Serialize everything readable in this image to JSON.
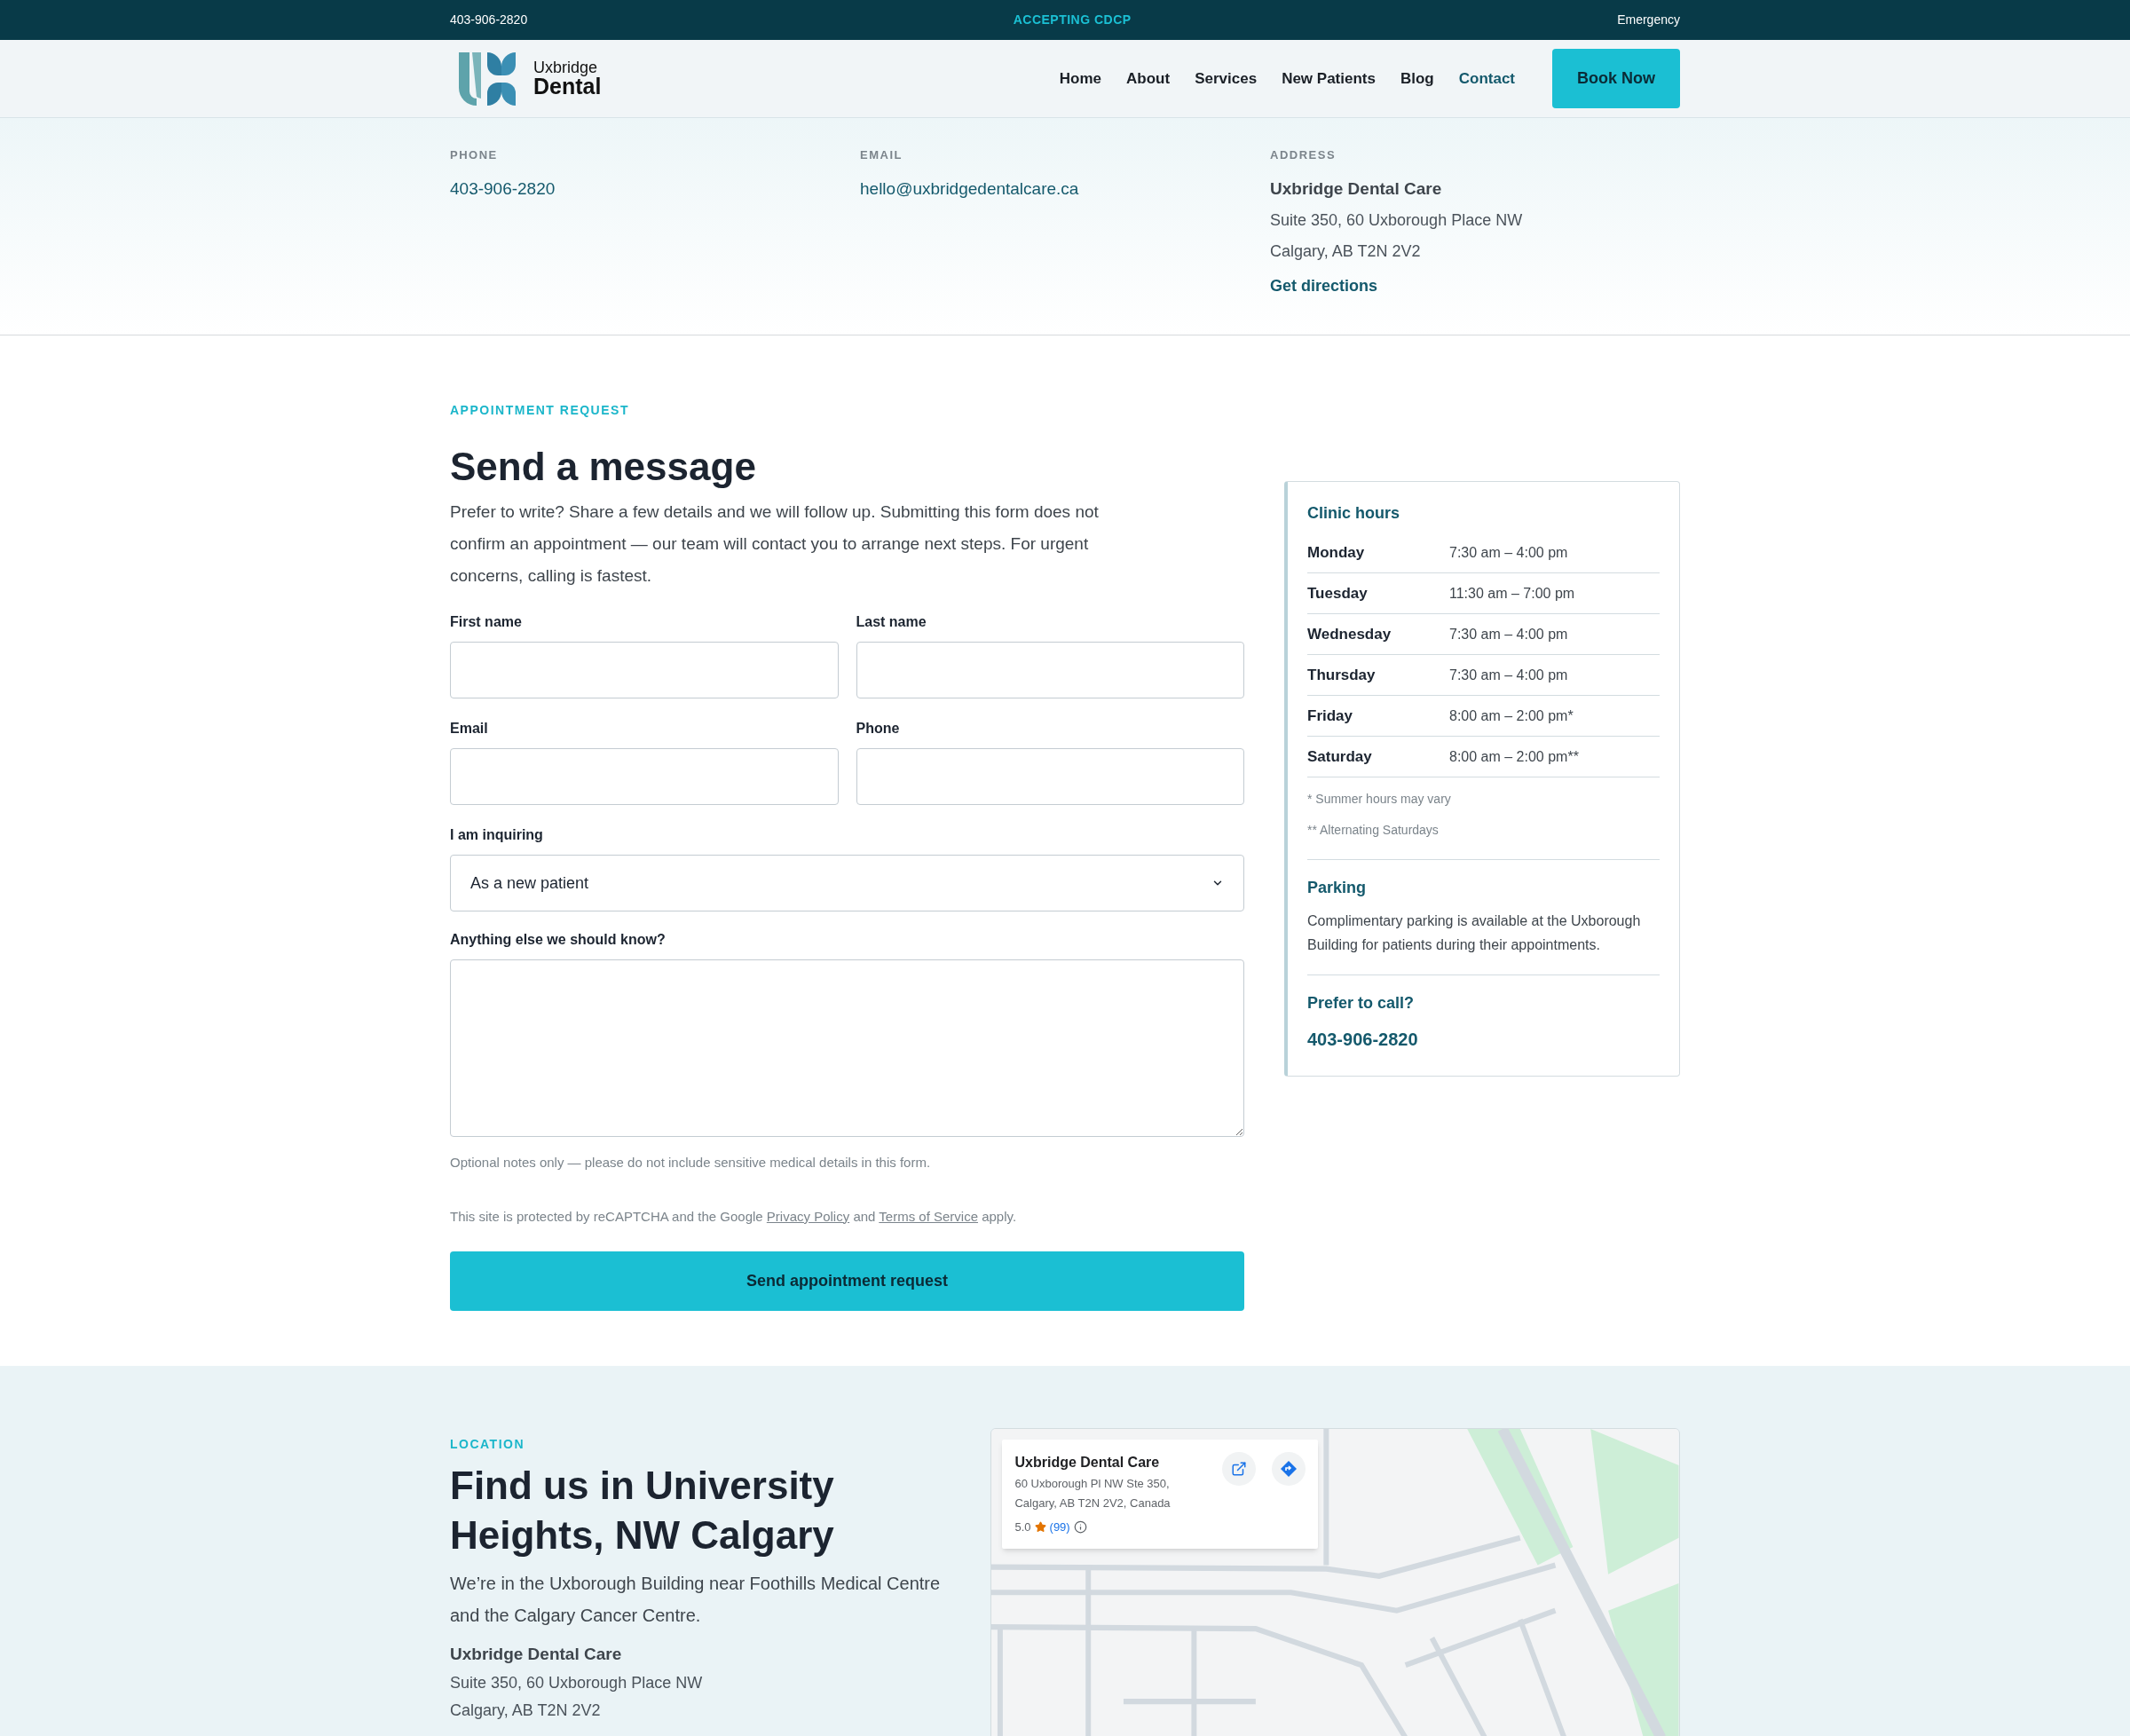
{
  "top_bar": {
    "phone": "403-906-2820",
    "badge": "ACCEPTING CDCP",
    "link": "Emergency"
  },
  "header": {
    "logo": {
      "line1": "Uxbridge",
      "line2": "Dental"
    },
    "nav": [
      {
        "label": "Home",
        "selected": false
      },
      {
        "label": "About",
        "selected": false
      },
      {
        "label": "Services",
        "selected": false
      },
      {
        "label": "New Patients",
        "selected": false
      },
      {
        "label": "Blog",
        "selected": false
      },
      {
        "label": "Contact",
        "selected": true
      }
    ],
    "cta": "Book Now"
  },
  "contact": {
    "phone": {
      "label": "PHONE",
      "value": "403-906-2820"
    },
    "email": {
      "label": "EMAIL",
      "value": "hello@uxbridgedentalcare.ca"
    },
    "address": {
      "label": "ADDRESS",
      "name": "Uxbridge Dental Care",
      "lines": [
        "Suite 350, 60 Uxborough Place NW",
        "Calgary, AB T2N 2V2"
      ],
      "link": "Get directions"
    }
  },
  "form": {
    "eyebrow": "APPOINTMENT REQUEST",
    "title": "Send a message",
    "intro": "Prefer to write? Share a few details and we will follow up. Submitting this form does not confirm an appointment — our team will contact you to arrange next steps. For urgent concerns, calling is fastest.",
    "fields": [
      {
        "label": "First name"
      },
      {
        "label": "Last name"
      },
      {
        "label": "Email"
      },
      {
        "label": "Phone"
      }
    ],
    "select": {
      "label": "I am inquiring",
      "value": "As a new patient"
    },
    "textarea": {
      "label": "Anything else we should know?"
    },
    "note": "Optional notes only — please do not include sensitive medical details in this form.",
    "recaptcha": [
      {
        "kind": "text",
        "text": "This site is protected by reCAPTCHA and the Google"
      },
      {
        "kind": "link",
        "text": "Privacy Policy"
      },
      {
        "kind": "text",
        "text": "and"
      },
      {
        "kind": "link",
        "text": "Terms of Service"
      },
      {
        "kind": "text",
        "text": "apply."
      }
    ],
    "submit": "Send appointment request"
  },
  "sidebar": {
    "hours_title": "Clinic hours",
    "hours": [
      {
        "day": "Monday",
        "time": "7:30 am – 4:00 pm"
      },
      {
        "day": "Tuesday",
        "time": "11:30 am – 7:00 pm"
      },
      {
        "day": "Wednesday",
        "time": "7:30 am – 4:00 pm"
      },
      {
        "day": "Thursday",
        "time": "7:30 am – 4:00 pm"
      },
      {
        "day": "Friday",
        "time": "8:00 am – 2:00 pm*"
      },
      {
        "day": "Saturday",
        "time": "8:00 am – 2:00 pm**"
      }
    ],
    "footnotes": [
      "* Summer hours may vary",
      "** Alternating Saturdays"
    ],
    "parking_title": "Parking",
    "parking_text": "Complimentary parking is available at the Uxborough Building for patients during their appointments.",
    "call_title": "Prefer to call?",
    "call_phone": "403-906-2820"
  },
  "location": {
    "eyebrow": "LOCATION",
    "title": "Find us in University Heights, NW Calgary",
    "text": "We’re in the Uxborough Building near Foothills Medical Centre and the Calgary Cancer Centre.",
    "name": "Uxbridge Dental Care",
    "lines": [
      "Suite 350, 60 Uxborough Place NW",
      "Calgary, AB T2N 2V2"
    ]
  },
  "map_card": {
    "name": "Uxbridge Dental Care",
    "address": [
      "60 Uxborough Pl NW Ste 350,",
      "Calgary, AB T2N 2V2, Canada"
    ],
    "rating": "5.0",
    "reviews": "(99)"
  }
}
